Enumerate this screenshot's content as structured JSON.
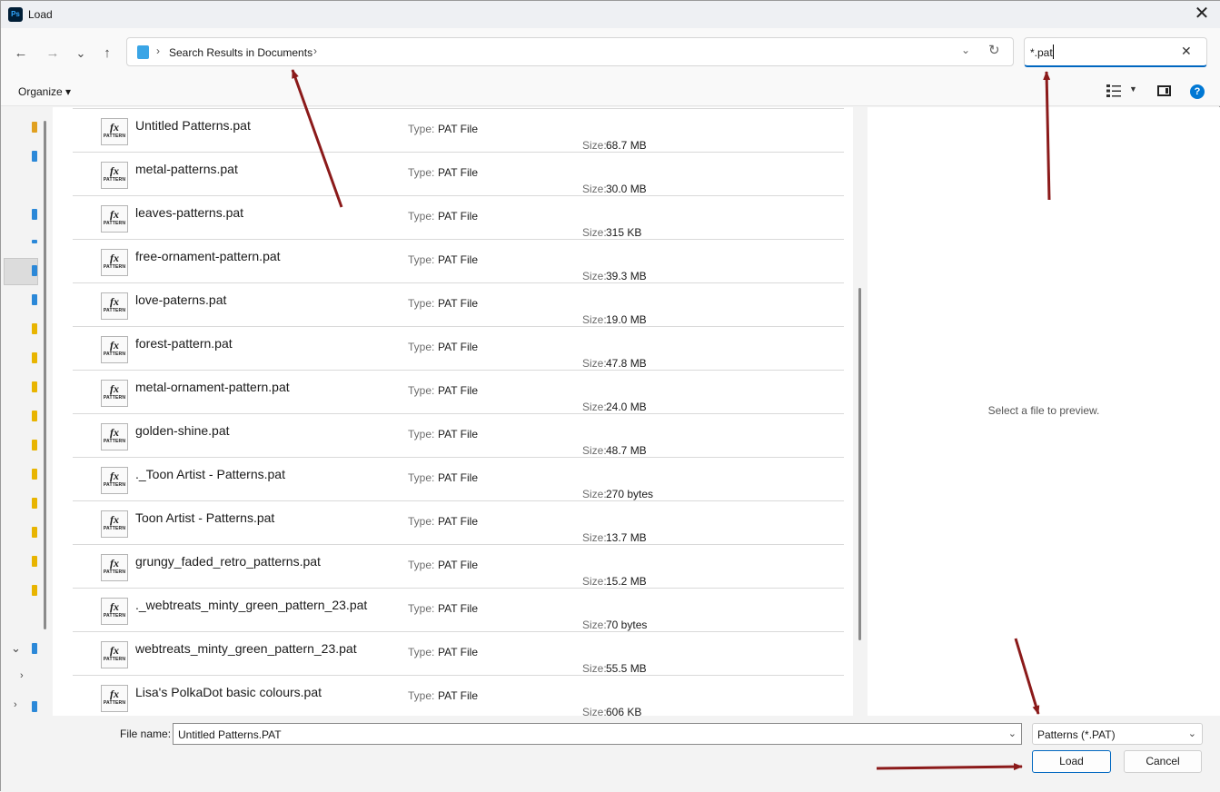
{
  "window": {
    "title": "Load",
    "app_icon_text": "Ps"
  },
  "nav": {
    "back": "←",
    "forward": "→",
    "recent": "⌄",
    "up": "↑",
    "breadcrumb": "Search Results in Documents",
    "sep1": "›",
    "sep2": "›",
    "dropdown": "⌄",
    "refresh": "↻",
    "search_value": "*.pat",
    "search_clear": "✕"
  },
  "command": {
    "organize": "Organize ▾",
    "view_dropdown": "▼",
    "help": "?"
  },
  "left_nav": {
    "chevron_expanded": "⌄",
    "chevron_collapsed_1": "›",
    "chevron_collapsed_2": "›"
  },
  "list": {
    "type_label": "Type:",
    "size_label": "Size:",
    "icon_fx": "fx",
    "icon_caption": "PATTERN",
    "files": [
      {
        "name": "Untitled Patterns.pat",
        "type": "PAT File",
        "size": "68.7 MB"
      },
      {
        "name": "metal-patterns.pat",
        "type": "PAT File",
        "size": "30.0 MB"
      },
      {
        "name": "leaves-patterns.pat",
        "type": "PAT File",
        "size": "315 KB"
      },
      {
        "name": "free-ornament-pattern.pat",
        "type": "PAT File",
        "size": "39.3 MB"
      },
      {
        "name": "love-paterns.pat",
        "type": "PAT File",
        "size": "19.0 MB"
      },
      {
        "name": "forest-pattern.pat",
        "type": "PAT File",
        "size": "47.8 MB"
      },
      {
        "name": "metal-ornament-pattern.pat",
        "type": "PAT File",
        "size": "24.0 MB"
      },
      {
        "name": "golden-shine.pat",
        "type": "PAT File",
        "size": "48.7 MB"
      },
      {
        "name": "._Toon Artist - Patterns.pat",
        "type": "PAT File",
        "size": "270 bytes"
      },
      {
        "name": "Toon Artist - Patterns.pat",
        "type": "PAT File",
        "size": "13.7 MB"
      },
      {
        "name": "grungy_faded_retro_patterns.pat",
        "type": "PAT File",
        "size": "15.2 MB"
      },
      {
        "name": "._webtreats_minty_green_pattern_23.pat",
        "type": "PAT File",
        "size": "70 bytes"
      },
      {
        "name": "webtreats_minty_green_pattern_23.pat",
        "type": "PAT File",
        "size": "55.5 MB"
      },
      {
        "name": "Lisa's PolkaDot basic colours.pat",
        "type": "PAT File",
        "size": "606 KB"
      }
    ]
  },
  "preview": {
    "empty_text": "Select a file to preview."
  },
  "bottom": {
    "file_name_label": "File name:",
    "file_name_value": "Untitled Patterns.PAT",
    "file_type_value": "Patterns (*.PAT)",
    "dropdown": "⌄",
    "load_label": "Load",
    "cancel_label": "Cancel"
  },
  "colors": {
    "accent": "#0067c0",
    "annotation_arrow": "#8b1a1a",
    "help": "#0078d4"
  }
}
